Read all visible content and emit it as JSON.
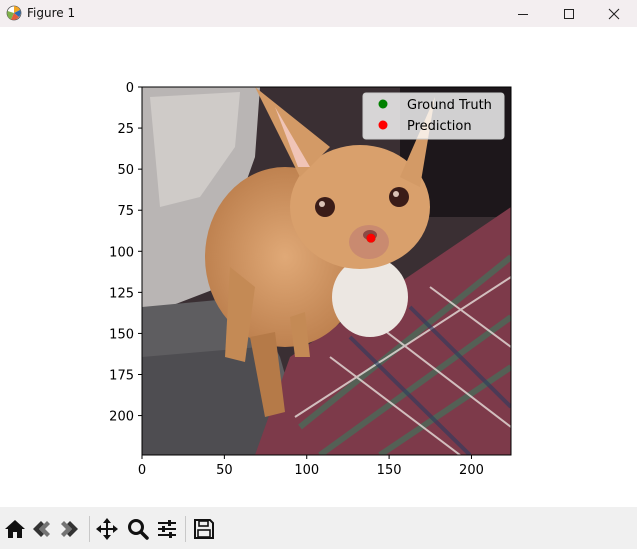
{
  "window": {
    "title": "Figure 1",
    "controls": [
      "minimize",
      "maximize",
      "close"
    ]
  },
  "chart_data": {
    "type": "scatter",
    "image_background": "photo of a tan chihuahua sitting on a plaid blanket",
    "xlim": [
      0,
      224
    ],
    "ylim": [
      224,
      0
    ],
    "x_ticks": [
      0,
      50,
      100,
      150,
      200
    ],
    "y_ticks": [
      0,
      25,
      50,
      75,
      100,
      125,
      150,
      175,
      200
    ],
    "x_tick_labels": [
      "0",
      "50",
      "100",
      "150",
      "200"
    ],
    "y_tick_labels": [
      "0",
      "25",
      "50",
      "75",
      "100",
      "125",
      "150",
      "175",
      "200"
    ],
    "legend_position": "top-right",
    "series": [
      {
        "name": "Ground Truth",
        "color": "#008000",
        "points": [
          [
            139,
            92
          ]
        ]
      },
      {
        "name": "Prediction",
        "color": "#ff0000",
        "points": [
          [
            139,
            92
          ]
        ]
      }
    ]
  },
  "toolbar": {
    "items": [
      "home-icon",
      "back-icon",
      "forward-icon",
      "pan-icon",
      "zoom-icon",
      "configure-icon",
      "save-icon"
    ]
  }
}
